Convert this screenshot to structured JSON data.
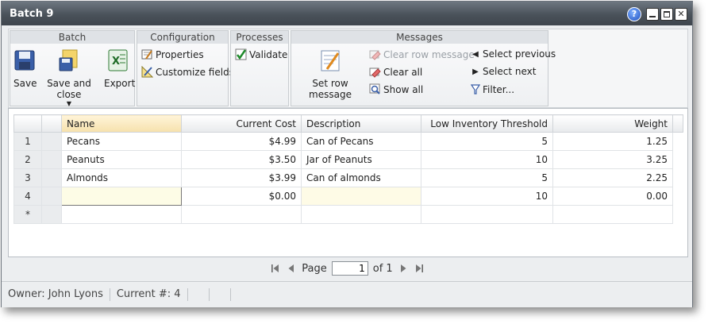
{
  "window": {
    "title": "Batch 9"
  },
  "ribbon": {
    "batch": {
      "header": "Batch",
      "save": "Save",
      "save_close": "Save and close",
      "export": "Export"
    },
    "configuration": {
      "header": "Configuration",
      "properties": "Properties",
      "customize": "Customize fields"
    },
    "processes": {
      "header": "Processes",
      "validate": "Validate"
    },
    "messages": {
      "header": "Messages",
      "set_row_message": "Set row message",
      "clear_row_message": "Clear row message",
      "clear_all": "Clear all",
      "show_all": "Show all",
      "select_previous": "Select previous",
      "select_next": "Select next",
      "filter": "Filter..."
    }
  },
  "grid": {
    "columns": [
      "Name",
      "Current Cost",
      "Description",
      "Low Inventory Threshold",
      "Weight"
    ],
    "rows": [
      {
        "num": "1",
        "name": "Pecans",
        "cost": "$4.99",
        "desc": "Can of Pecans",
        "threshold": "5",
        "weight": "1.25"
      },
      {
        "num": "2",
        "name": "Peanuts",
        "cost": "$3.50",
        "desc": "Jar of Peanuts",
        "threshold": "10",
        "weight": "3.25"
      },
      {
        "num": "3",
        "name": "Almonds",
        "cost": "$3.99",
        "desc": "Can of almonds",
        "threshold": "5",
        "weight": "2.25"
      },
      {
        "num": "4",
        "name": "",
        "cost": "$0.00",
        "desc": "",
        "threshold": "10",
        "weight": "0.00"
      }
    ],
    "new_row_marker": "*"
  },
  "pager": {
    "page_label": "Page",
    "page_value": "1",
    "of_label": "of 1"
  },
  "status": {
    "owner_label": "Owner:",
    "owner": "John Lyons",
    "current_label": "Current #:",
    "current": "4"
  },
  "colors": {
    "titlebar": "#4a525a",
    "header_sorted": "#f6e1ad",
    "edit_cell": "#fdfce6"
  }
}
